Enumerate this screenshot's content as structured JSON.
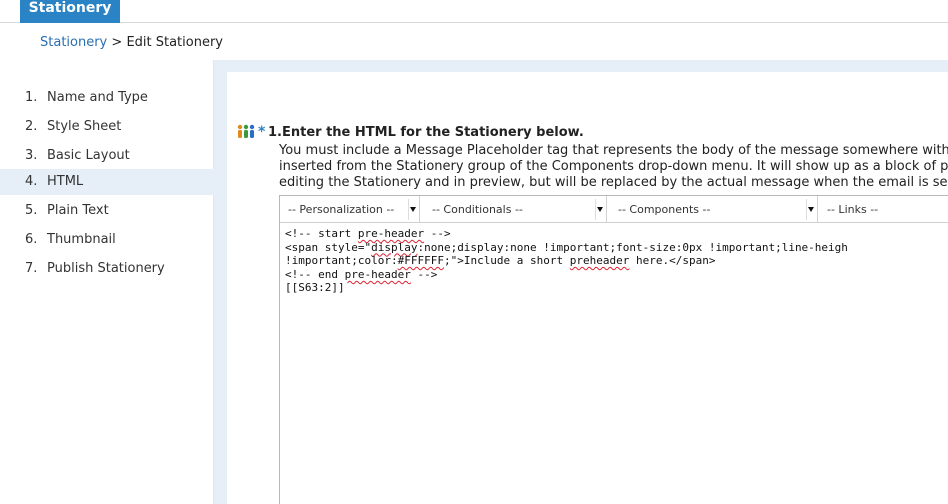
{
  "header": {
    "tab_label": "Stationery"
  },
  "breadcrumb": {
    "link": "Stationery",
    "separator": " > ",
    "current": "Edit Stationery"
  },
  "sidebar": {
    "items": [
      {
        "num": "1.",
        "label": "Name and Type"
      },
      {
        "num": "2.",
        "label": "Style Sheet"
      },
      {
        "num": "3.",
        "label": "Basic Layout"
      },
      {
        "num": "4.",
        "label": "HTML",
        "active": true
      },
      {
        "num": "5.",
        "label": "Plain Text"
      },
      {
        "num": "6.",
        "label": "Thumbnail"
      },
      {
        "num": "7.",
        "label": "Publish Stationery"
      }
    ]
  },
  "step": {
    "marker": "*",
    "title": "1.Enter the HTML for the Stationery below.",
    "description": [
      "You must include a Message Placeholder tag that represents the body of the message somewhere within your",
      "inserted from the Stationery group of the Components drop-down menu. It will show up as a block of placeholo",
      "editing the Stationery and in preview, but will be replaced by the actual message when the email is sent."
    ]
  },
  "toolbar": {
    "personalization": "-- Personalization --",
    "conditionals": "-- Conditionals --",
    "components": "-- Components --",
    "links": "-- Links --"
  },
  "code": {
    "l1a": "<!-- start ",
    "l1b": "pre-header",
    "l1c": " -->",
    "l2a": "<span style=\"",
    "l2b": "display",
    "l2c": ":none;display:none !important;font-size:0px !important;line-heigh",
    "l3a": "!important;color:",
    "l3b": "#FFFFFF",
    "l3c": ";\">Include a short ",
    "l3d": "preheader",
    "l3e": " here.</span>",
    "l4a": "<!-- end ",
    "l4b": "pre-header",
    "l4c": " -->",
    "l5": "[[S63:2]]"
  },
  "colors": {
    "accent": "#2a83c4",
    "link": "#2a6fb0",
    "panel_bg": "#e6eff8"
  }
}
